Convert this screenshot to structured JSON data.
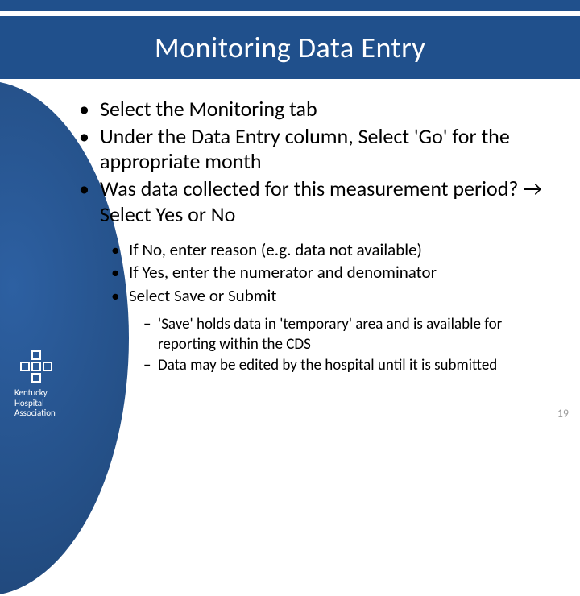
{
  "title": "Monitoring Data Entry",
  "bullets": {
    "b1": "Select the Monitoring tab",
    "b2": "Under the Data Entry column, Select 'Go' for the appropriate month",
    "b3": "Was data collected for this measurement period? → Select Yes or No",
    "sub": {
      "s1": "If No, enter reason (e.g. data not available)",
      "s2": "If Yes, enter the numerator and denominator",
      "s3": "Select Save or Submit",
      "sub2": {
        "d1": "'Save' holds data in 'temporary' area and is available for reporting within the CDS",
        "d2": " Data may be edited by the hospital until it is submitted"
      }
    }
  },
  "logo": {
    "line1": "Kentucky",
    "line2": "Hospital",
    "line3": "Association"
  },
  "page_number": "19"
}
